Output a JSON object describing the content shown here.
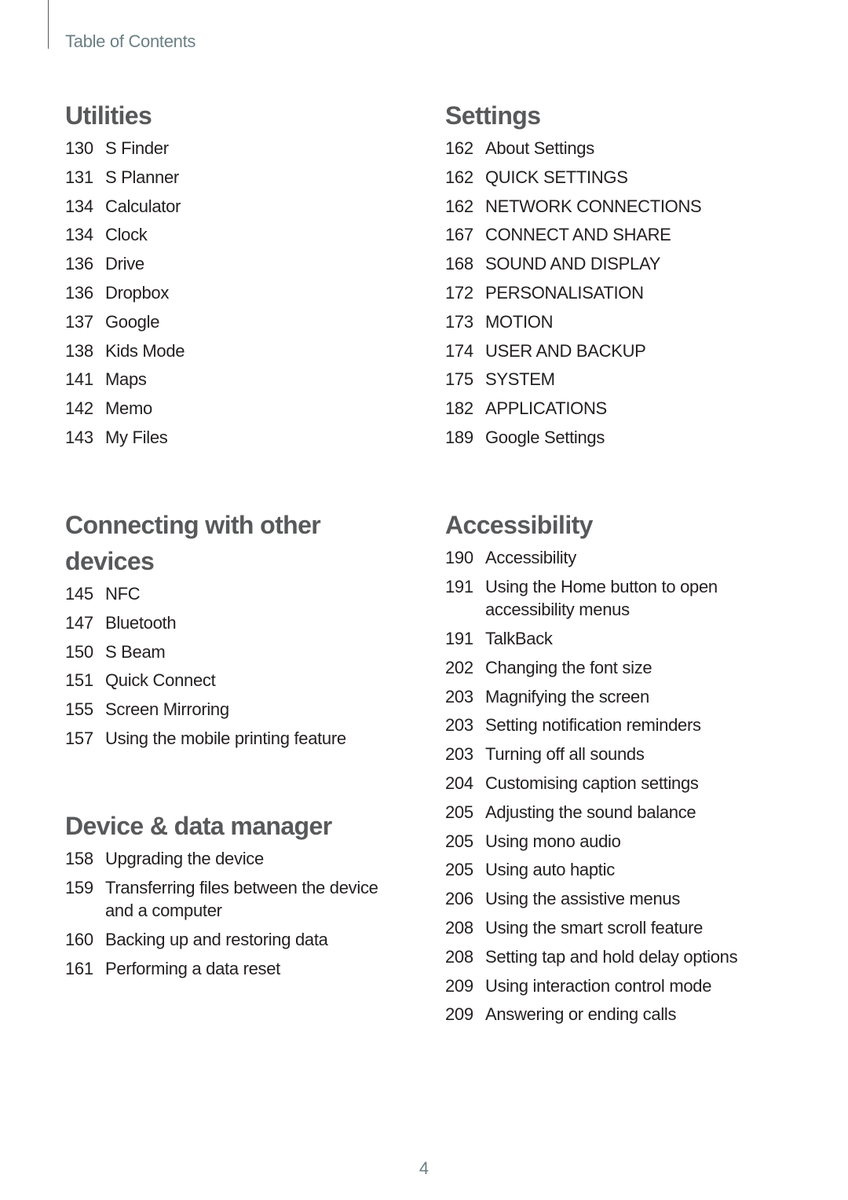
{
  "header": {
    "title": "Table of Contents"
  },
  "sections": {
    "utilities": {
      "title": "Utilities",
      "items": [
        {
          "page": "130",
          "label": "S Finder"
        },
        {
          "page": "131",
          "label": "S Planner"
        },
        {
          "page": "134",
          "label": "Calculator"
        },
        {
          "page": "134",
          "label": "Clock"
        },
        {
          "page": "136",
          "label": "Drive"
        },
        {
          "page": "136",
          "label": "Dropbox"
        },
        {
          "page": "137",
          "label": "Google"
        },
        {
          "page": "138",
          "label": "Kids Mode"
        },
        {
          "page": "141",
          "label": "Maps"
        },
        {
          "page": "142",
          "label": "Memo"
        },
        {
          "page": "143",
          "label": "My Files"
        }
      ]
    },
    "connecting": {
      "title": "Connecting with other devices",
      "items": [
        {
          "page": "145",
          "label": "NFC"
        },
        {
          "page": "147",
          "label": "Bluetooth"
        },
        {
          "page": "150",
          "label": "S Beam"
        },
        {
          "page": "151",
          "label": "Quick Connect"
        },
        {
          "page": "155",
          "label": "Screen Mirroring"
        },
        {
          "page": "157",
          "label": "Using the mobile printing feature"
        }
      ]
    },
    "device_data_manager": {
      "title": "Device & data manager",
      "items": [
        {
          "page": "158",
          "label": "Upgrading the device"
        },
        {
          "page": "159",
          "label": "Transferring files between the device and a computer"
        },
        {
          "page": "160",
          "label": "Backing up and restoring data"
        },
        {
          "page": "161",
          "label": "Performing a data reset"
        }
      ]
    },
    "settings": {
      "title": "Settings",
      "items": [
        {
          "page": "162",
          "label": "About Settings"
        },
        {
          "page": "162",
          "label": "QUICK SETTINGS"
        },
        {
          "page": "162",
          "label": "NETWORK CONNECTIONS"
        },
        {
          "page": "167",
          "label": "CONNECT AND SHARE"
        },
        {
          "page": "168",
          "label": "SOUND AND DISPLAY"
        },
        {
          "page": "172",
          "label": "PERSONALISATION"
        },
        {
          "page": "173",
          "label": "MOTION"
        },
        {
          "page": "174",
          "label": "USER AND BACKUP"
        },
        {
          "page": "175",
          "label": "SYSTEM"
        },
        {
          "page": "182",
          "label": "APPLICATIONS"
        },
        {
          "page": "189",
          "label": "Google Settings"
        }
      ]
    },
    "accessibility": {
      "title": "Accessibility",
      "items": [
        {
          "page": "190",
          "label": "Accessibility"
        },
        {
          "page": "191",
          "label": "Using the Home button to open accessibility menus"
        },
        {
          "page": "191",
          "label": "TalkBack"
        },
        {
          "page": "202",
          "label": "Changing the font size"
        },
        {
          "page": "203",
          "label": "Magnifying the screen"
        },
        {
          "page": "203",
          "label": "Setting notification reminders"
        },
        {
          "page": "203",
          "label": "Turning off all sounds"
        },
        {
          "page": "204",
          "label": "Customising caption settings"
        },
        {
          "page": "205",
          "label": "Adjusting the sound balance"
        },
        {
          "page": "205",
          "label": "Using mono audio"
        },
        {
          "page": "205",
          "label": "Using auto haptic"
        },
        {
          "page": "206",
          "label": "Using the assistive menus"
        },
        {
          "page": "208",
          "label": "Using the smart scroll feature"
        },
        {
          "page": "208",
          "label": "Setting tap and hold delay options"
        },
        {
          "page": "209",
          "label": "Using interaction control mode"
        },
        {
          "page": "209",
          "label": "Answering or ending calls"
        }
      ]
    }
  },
  "footer": {
    "page_number": "4"
  }
}
